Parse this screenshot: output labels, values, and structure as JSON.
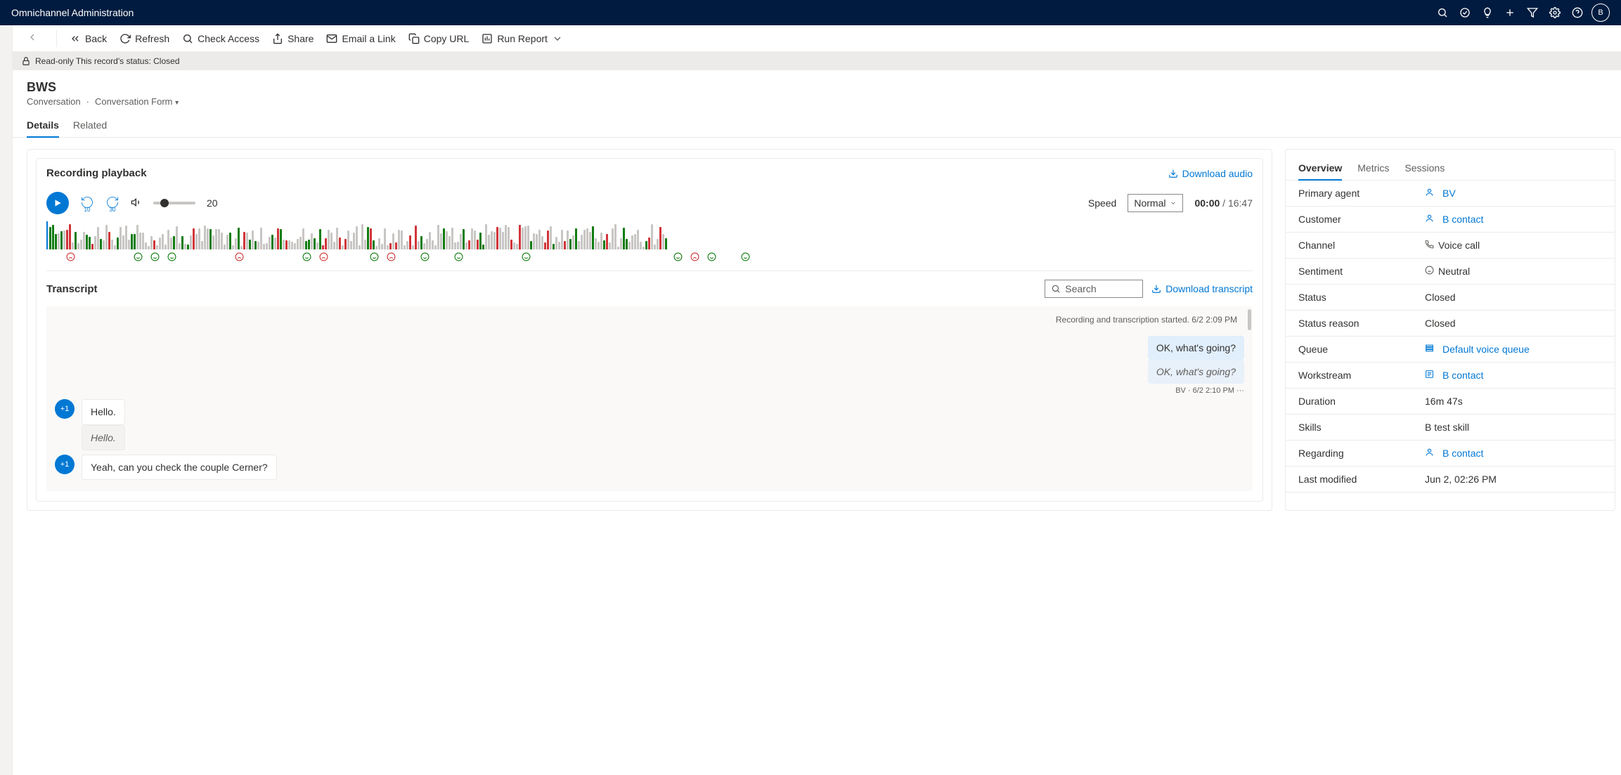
{
  "header": {
    "app_title": "Omnichannel Administration"
  },
  "commandbar": {
    "back": "Back",
    "refresh": "Refresh",
    "check_access": "Check Access",
    "share": "Share",
    "email_link": "Email a Link",
    "copy_url": "Copy URL",
    "run_report": "Run Report"
  },
  "banner": {
    "text": "Read-only This record's status: Closed"
  },
  "page": {
    "title": "BWS",
    "entity": "Conversation",
    "form": "Conversation Form"
  },
  "tabs": {
    "details": "Details",
    "related": "Related"
  },
  "recording": {
    "title": "Recording playback",
    "download": "Download audio",
    "skip_back": "10",
    "skip_fwd": "30",
    "volume": "20",
    "speed_label": "Speed",
    "speed_value": "Normal",
    "time_current": "00:00",
    "time_total": "16:47"
  },
  "transcript": {
    "title": "Transcript",
    "search_placeholder": "Search",
    "download": "Download transcript",
    "system_line": "Recording and transcription started. 6/2 2:09 PM",
    "agent_msgs": [
      {
        "text": "OK, what's going?",
        "stamp": "BV  · 6/2 2:10 PM  ···",
        "translated": "OK, what's going?"
      }
    ],
    "customer_groups": [
      {
        "badge": "+1",
        "lines": [
          "Hello.",
          "Hello."
        ]
      },
      {
        "badge": "+1",
        "lines": [
          "Yeah, can you check the couple Cerner?"
        ]
      }
    ]
  },
  "right": {
    "tabs": {
      "overview": "Overview",
      "metrics": "Metrics",
      "sessions": "Sessions"
    },
    "fields": {
      "primary_agent": {
        "label": "Primary agent",
        "value": "BV",
        "link": true,
        "icon": "person"
      },
      "customer": {
        "label": "Customer",
        "value": "B contact",
        "link": true,
        "icon": "person"
      },
      "channel": {
        "label": "Channel",
        "value": "Voice call",
        "link": false,
        "icon": "phone"
      },
      "sentiment": {
        "label": "Sentiment",
        "value": "Neutral",
        "link": false,
        "icon": "face"
      },
      "status": {
        "label": "Status",
        "value": "Closed",
        "link": false
      },
      "status_reason": {
        "label": "Status reason",
        "value": "Closed",
        "link": false
      },
      "queue": {
        "label": "Queue",
        "value": "Default voice queue",
        "link": true,
        "icon": "queue"
      },
      "workstream": {
        "label": "Workstream",
        "value": "B contact",
        "link": true,
        "icon": "stream"
      },
      "duration": {
        "label": "Duration",
        "value": "16m 47s",
        "link": false
      },
      "skills": {
        "label": "Skills",
        "value": "B test skill",
        "link": false
      },
      "regarding": {
        "label": "Regarding",
        "value": "B contact",
        "link": true,
        "icon": "person"
      },
      "last_modified": {
        "label": "Last modified",
        "value": "Jun 2, 02:26 PM",
        "link": false
      }
    }
  }
}
